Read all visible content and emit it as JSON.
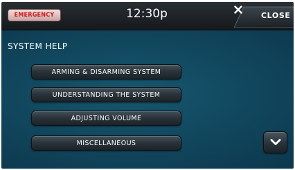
{
  "header": {
    "emergency_label": "EMERGENCY",
    "time": "12:30p",
    "close_label": "CLOSE"
  },
  "page": {
    "title": "SYSTEM HELP"
  },
  "menu": [
    {
      "label": "ARMING & DISARMING SYSTEM"
    },
    {
      "label": "UNDERSTANDING THE SYSTEM"
    },
    {
      "label": "ADJUSTING VOLUME"
    },
    {
      "label": "MISCELLANEOUS"
    }
  ],
  "icons": {
    "close": "close-x-icon",
    "scroll_down": "chevron-down-icon"
  },
  "colors": {
    "emergency_text": "#d01818",
    "background": "#0e3d53"
  }
}
